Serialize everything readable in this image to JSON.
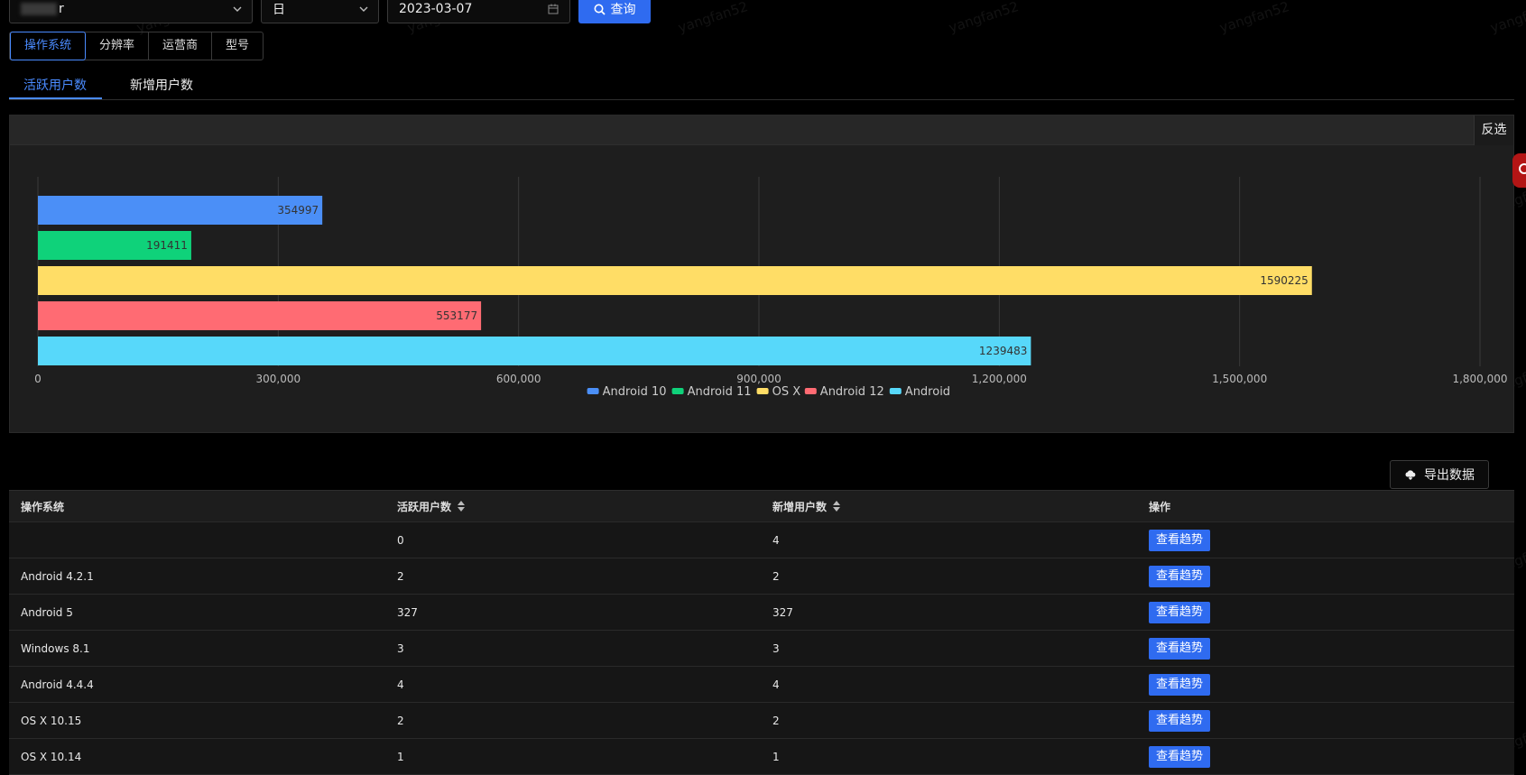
{
  "filters": {
    "app_select_value": "r",
    "period_select_value": "日",
    "date_value": "2023-03-07",
    "query_label": "查询"
  },
  "dimension_tabs": [
    "操作系统",
    "分辨率",
    "运营商",
    "型号"
  ],
  "metric_tabs": [
    "活跃用户数",
    "新增用户数"
  ],
  "chart_panel": {
    "invert_label": "反选"
  },
  "chart_data": {
    "type": "bar",
    "orientation": "horizontal",
    "series": [
      {
        "name": "Android 10",
        "value": 354997,
        "color": "#4b8ff7"
      },
      {
        "name": "Android 11",
        "value": 191411,
        "color": "#0fd27a"
      },
      {
        "name": "OS X",
        "value": 1590225,
        "color": "#ffdd66"
      },
      {
        "name": "Android 12",
        "value": 553177,
        "color": "#ff6b73"
      },
      {
        "name": "Android",
        "value": 1239483,
        "color": "#57d8fa"
      }
    ],
    "xticks": [
      "0",
      "300,000",
      "600,000",
      "900,000",
      "1,200,000",
      "1,500,000",
      "1,800,000"
    ],
    "xlim": [
      0,
      1800000
    ],
    "grid": true,
    "legend": "bottom-center"
  },
  "export_label": "导出数据",
  "table": {
    "headers": [
      "操作系统",
      "活跃用户数",
      "新增用户数",
      "操作"
    ],
    "rows": [
      {
        "os": "",
        "active": "0",
        "new": "4",
        "action": "查看趋势"
      },
      {
        "os": "Android 4.2.1",
        "active": "2",
        "new": "2",
        "action": "查看趋势"
      },
      {
        "os": "Android 5",
        "active": "327",
        "new": "327",
        "action": "查看趋势"
      },
      {
        "os": "Windows 8.1",
        "active": "3",
        "new": "3",
        "action": "查看趋势"
      },
      {
        "os": "Android 4.4.4",
        "active": "4",
        "new": "4",
        "action": "查看趋势"
      },
      {
        "os": "OS X 10.15",
        "active": "2",
        "new": "2",
        "action": "查看趋势"
      },
      {
        "os": "OS X 10.14",
        "active": "1",
        "new": "1",
        "action": "查看趋势"
      }
    ]
  },
  "watermark": "yangfan52"
}
